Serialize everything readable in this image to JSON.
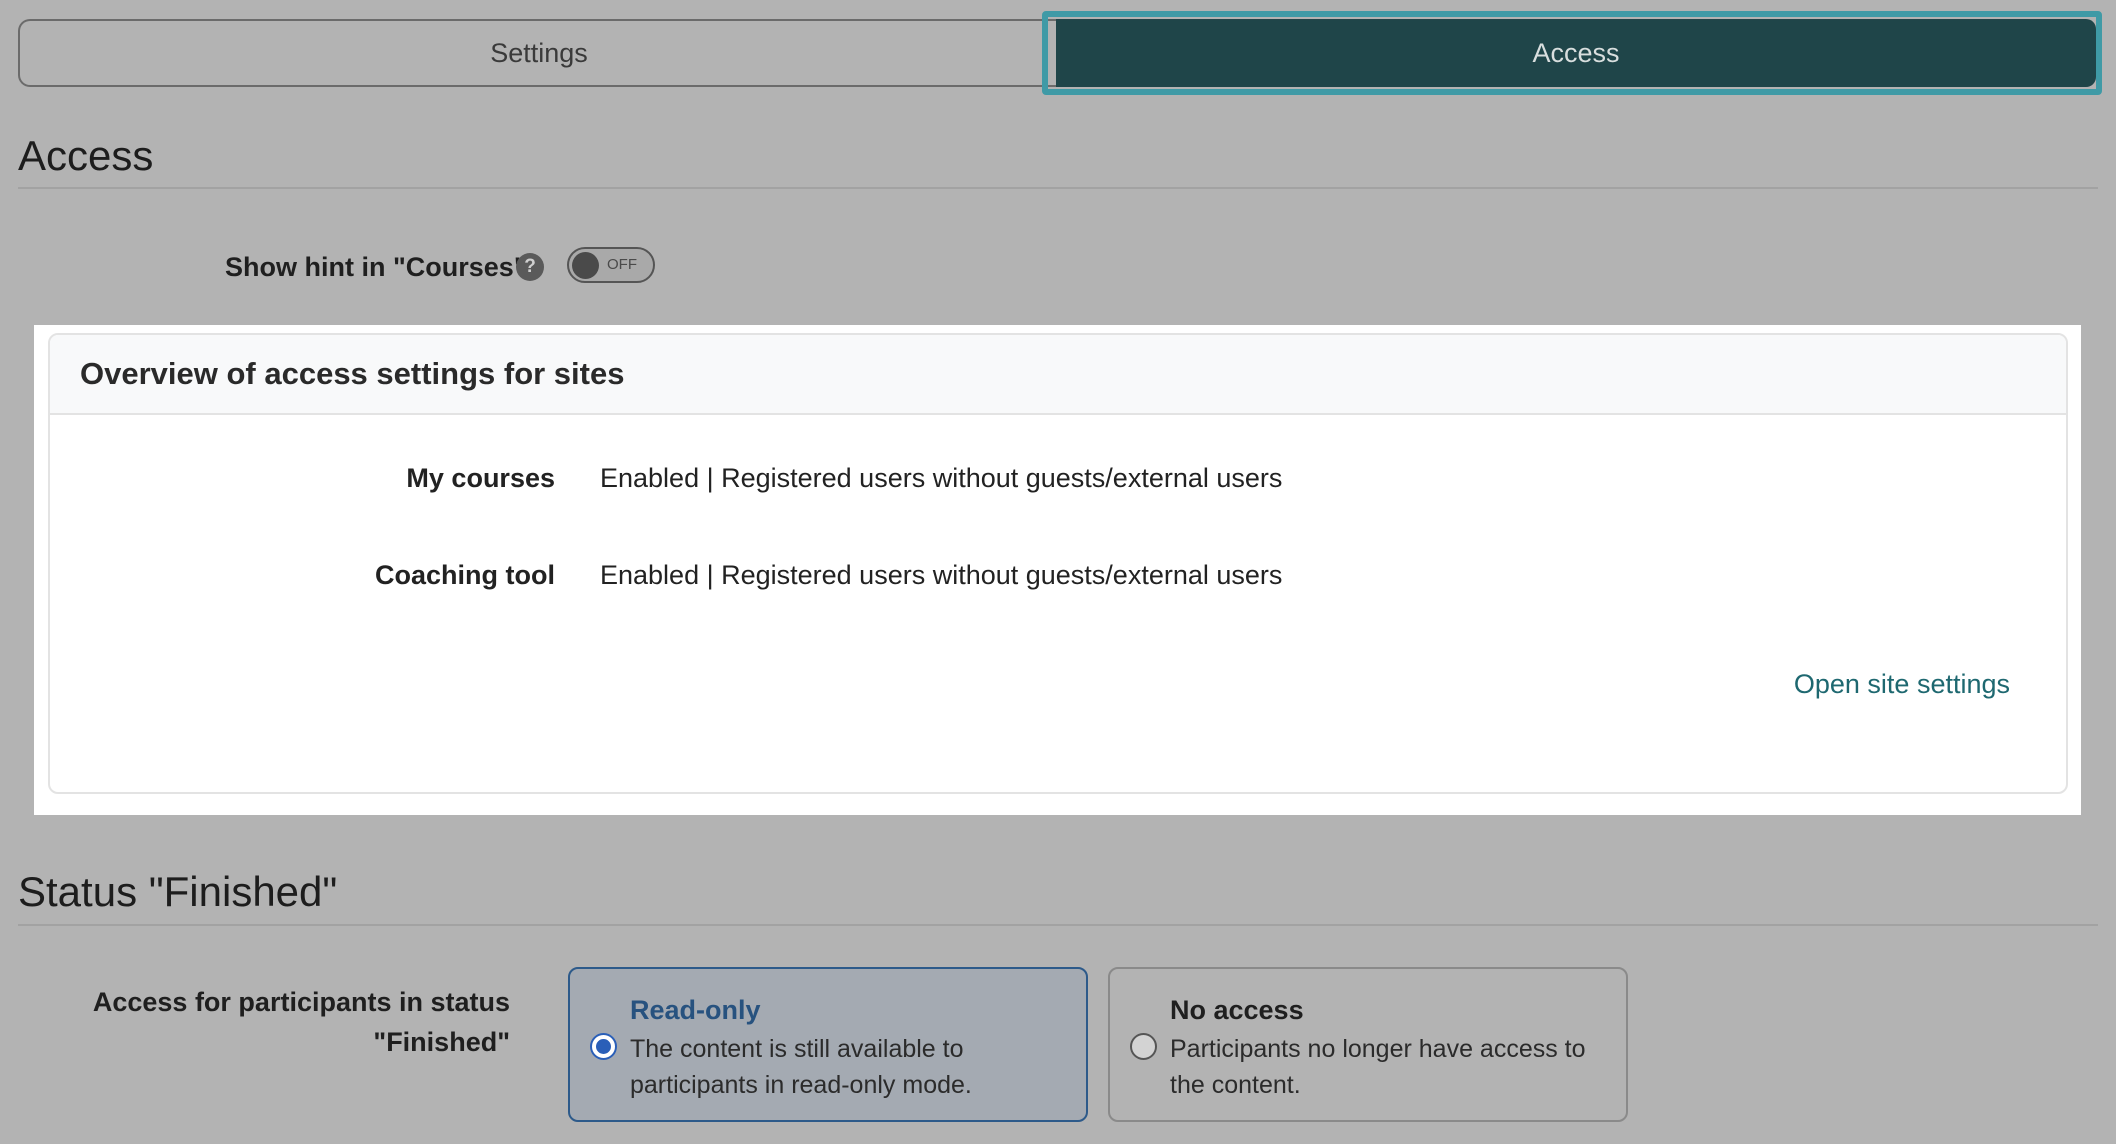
{
  "tabs": {
    "settings_label": "Settings",
    "access_label": "Access",
    "active": "Access"
  },
  "access_section": {
    "title": "Access",
    "show_hint_label": "Show hint in \"Courses\"",
    "help_icon": "question-circle-icon",
    "toggle_state": "OFF"
  },
  "overview_card": {
    "title": "Overview of access settings for sites",
    "rows": [
      {
        "label": "My courses",
        "value": "Enabled | Registered users without guests/external users"
      },
      {
        "label": "Coaching tool",
        "value": "Enabled | Registered users without guests/external users"
      }
    ],
    "link_label": "Open site settings"
  },
  "finished_section": {
    "title": "Status \"Finished\"",
    "field_label_line1": "Access for participants in status",
    "field_label_line2": "\"Finished\"",
    "options": [
      {
        "title": "Read-only",
        "desc_line1": "The content is still available to",
        "desc_line2": "participants in read-only mode.",
        "selected": true
      },
      {
        "title": "No access",
        "desc_line1": "Participants no longer have access to",
        "desc_line2": "the content.",
        "selected": false
      }
    ]
  },
  "colors": {
    "active_tab_bg": "#1f4549",
    "focus_ring": "#3f9aa6",
    "link": "#1e6870",
    "radio_selected": "#2a5fb8"
  }
}
